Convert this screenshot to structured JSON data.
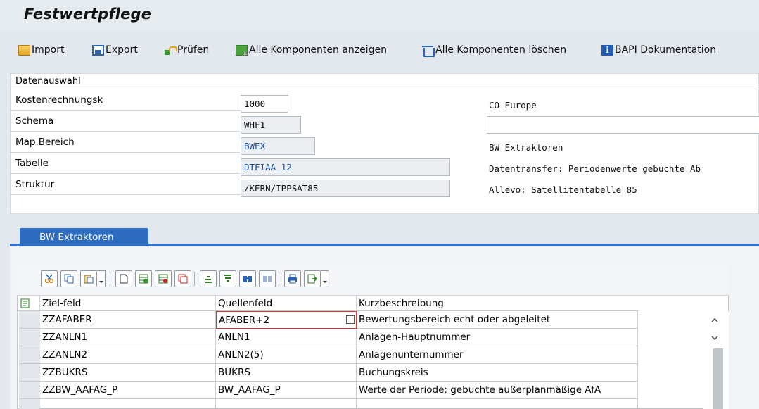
{
  "window": {
    "title": "Festwertpflege"
  },
  "toolbar": {
    "items": [
      {
        "icon": "folder-open-icon",
        "label": "Import"
      },
      {
        "icon": "save-icon",
        "label": "Export"
      },
      {
        "icon": "check-icon",
        "label": "Prüfen"
      },
      {
        "icon": "components-show-icon",
        "label": "Alle Komponenten anzeigen"
      },
      {
        "icon": "trash-icon",
        "label": "Alle Komponenten löschen"
      },
      {
        "icon": "info-icon",
        "label": "BAPI Dokumentation"
      }
    ]
  },
  "selection": {
    "header": "Datenauswahl",
    "rows": [
      {
        "label": "Kostenrechnungsk",
        "value": "1000",
        "desc": "CO Europe"
      },
      {
        "label": "Schema",
        "value": "WHF1",
        "desc": ""
      },
      {
        "label": "Map.Bereich",
        "value": "BWEX",
        "desc": "BW Extraktoren"
      },
      {
        "label": "Tabelle",
        "value": "DTFIAA_12",
        "desc": "Datentransfer: Periodenwerte gebuchte Ab"
      },
      {
        "label": "Struktur",
        "value": "/KERN/IPPSAT85",
        "desc": "Allevo: Satellitentabelle 85"
      }
    ]
  },
  "tabs": [
    {
      "label": "BW Extraktoren",
      "active": true
    }
  ],
  "grid": {
    "columns": [
      "Ziel-feld",
      "Quellenfeld",
      "Kurzbeschreibung"
    ],
    "rows": [
      [
        "ZZAFABER",
        "AFABER+2",
        "Bewertungsbereich echt oder abgeleitet"
      ],
      [
        "ZZANLN1",
        "ANLN1",
        "Anlagen-Hauptnummer"
      ],
      [
        "ZZANLN2",
        "ANLN2(5)",
        "Anlagenunternummer"
      ],
      [
        "ZZBUKRS",
        "BUKRS",
        "Buchungskreis"
      ],
      [
        "ZZBW_AAFAG_P",
        "BW_AAFAG_P",
        "Werte der Periode: gebuchte außerplanmäßige AfA"
      ]
    ],
    "active_cell": {
      "row": 0,
      "col": 1
    }
  },
  "colors": {
    "tab_active": "#2e6cc0",
    "field_value_link": "#1a4fa0",
    "active_cell_border": "#dd3333"
  }
}
